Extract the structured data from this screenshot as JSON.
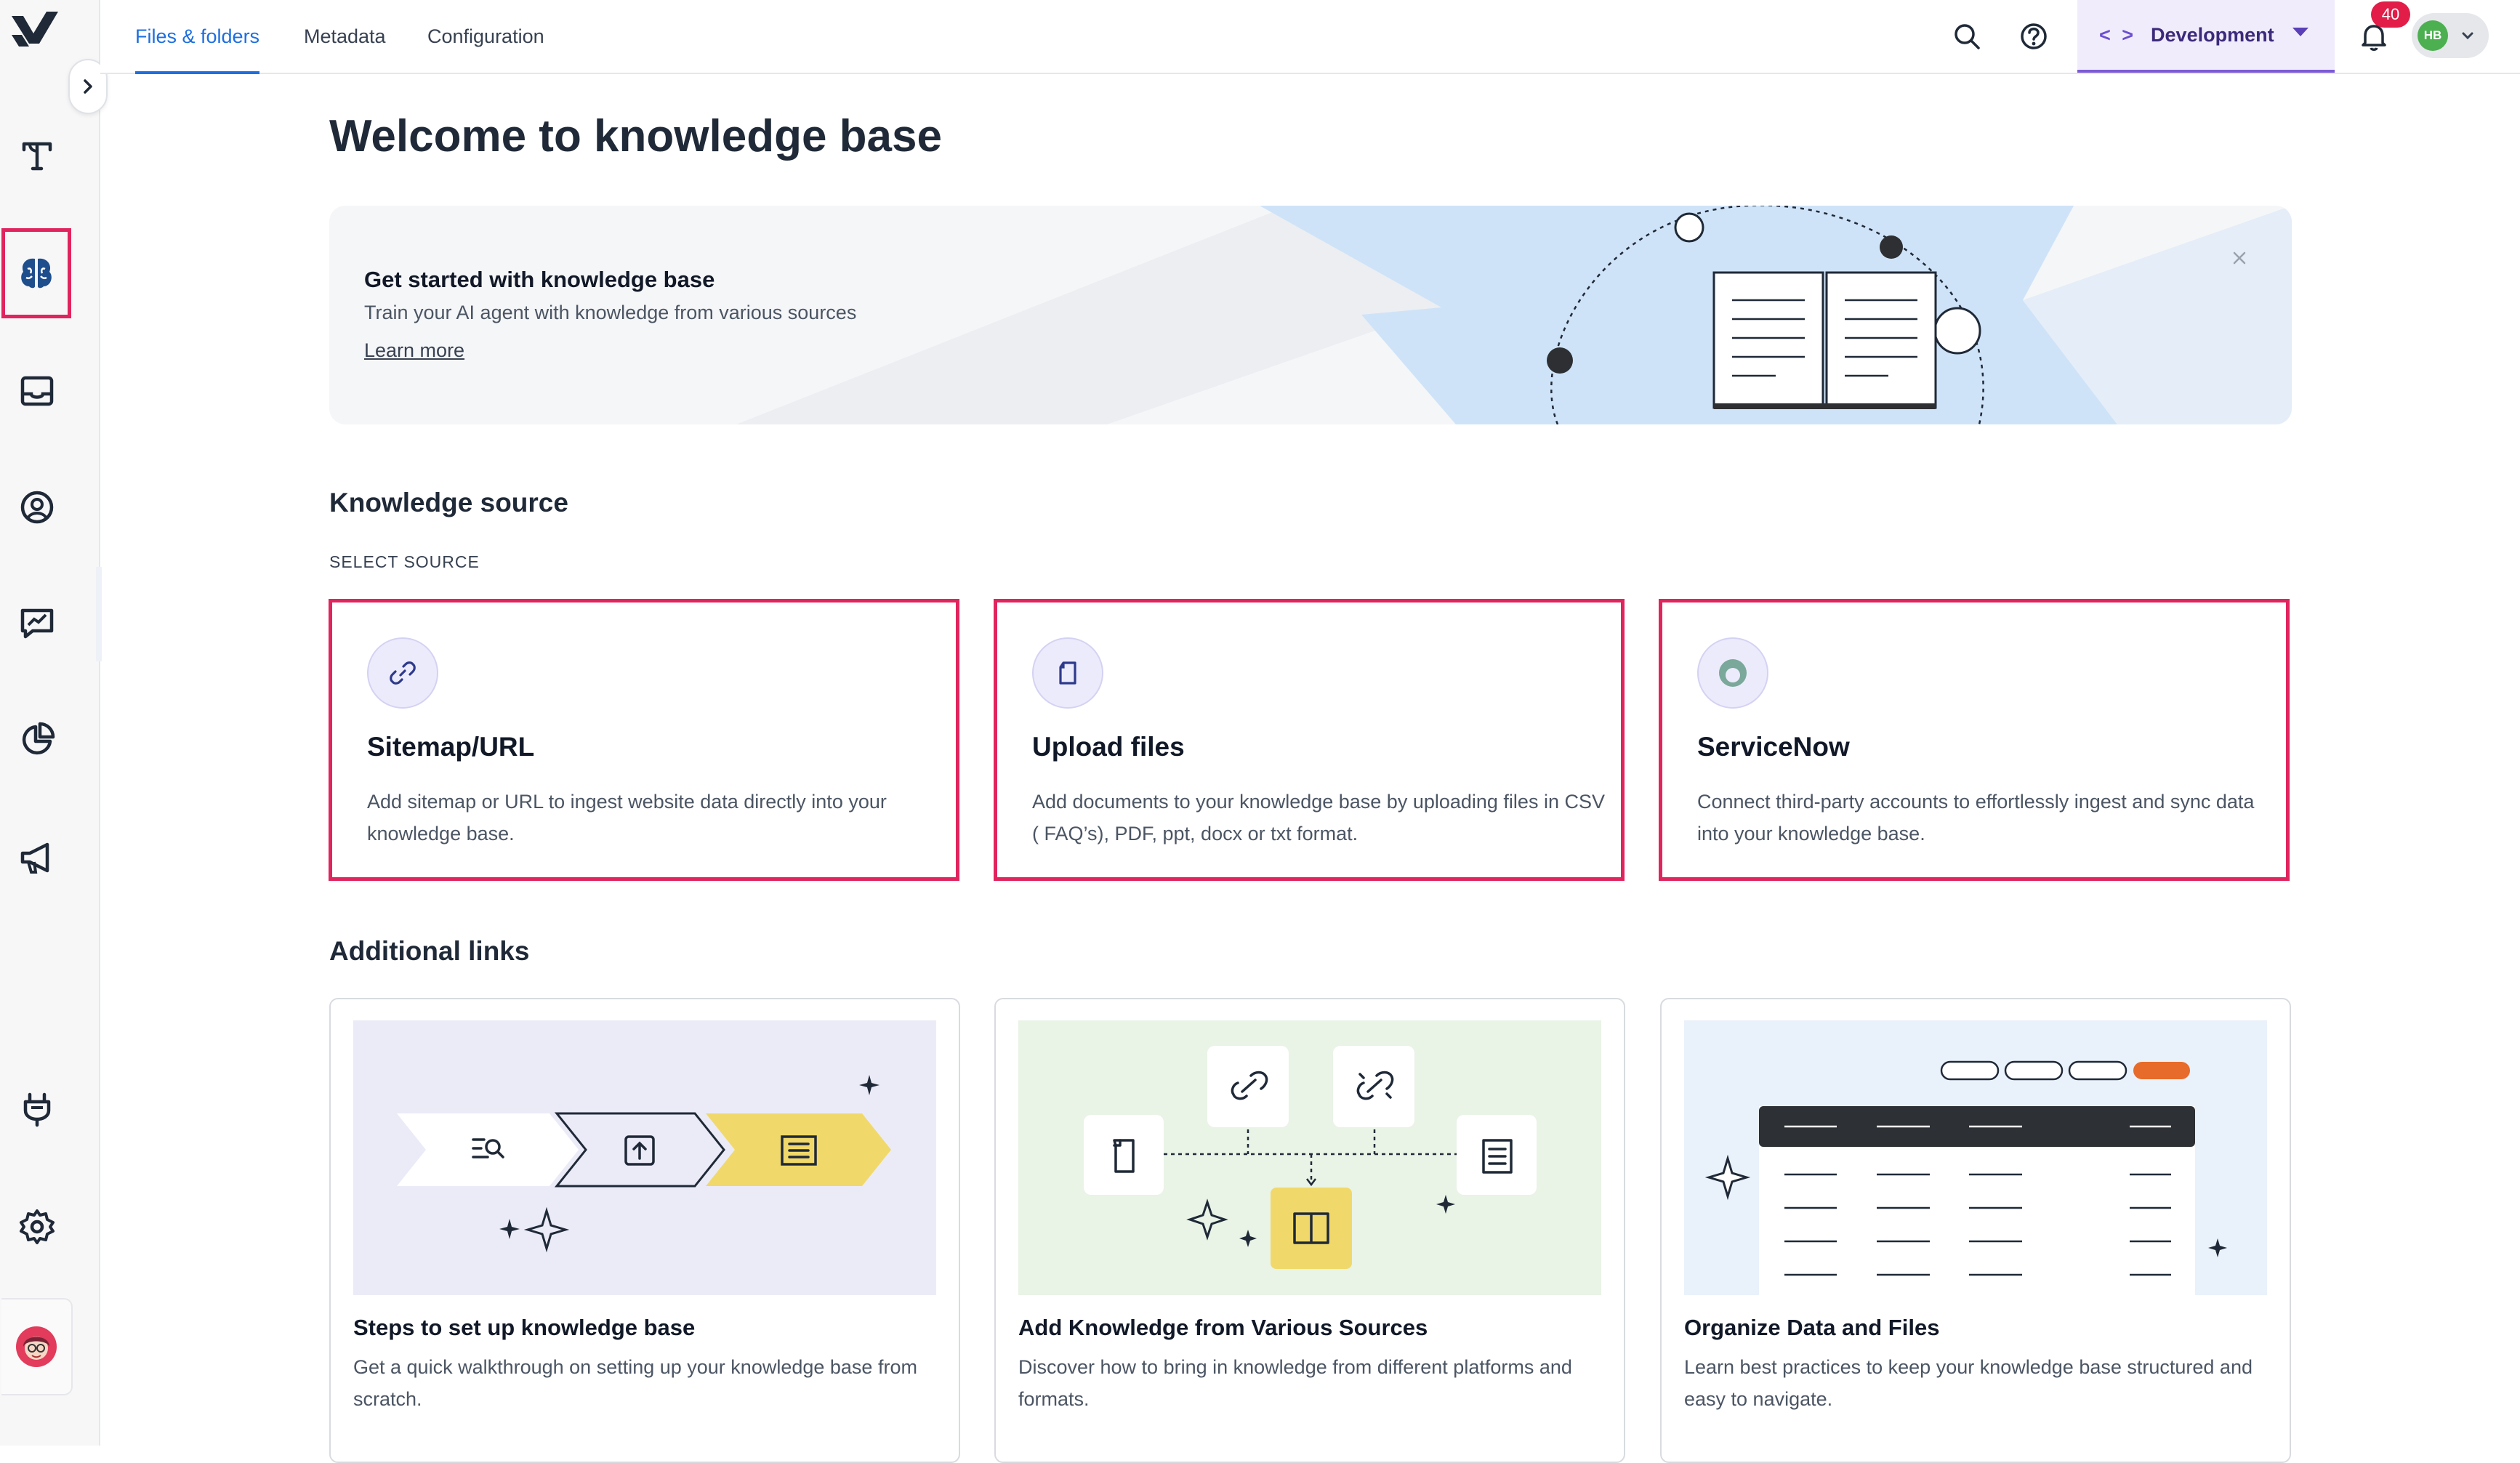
{
  "topbar": {
    "tabs": [
      {
        "label": "Files & folders"
      },
      {
        "label": "Metadata"
      },
      {
        "label": "Configuration"
      }
    ],
    "environment": "Development",
    "environment_code_glyph": "< >",
    "notifications_count": "40",
    "user_initials": "HB"
  },
  "rail": {
    "icons": [
      "logo-icon",
      "text-tool-icon",
      "knowledge-brain-icon",
      "inbox-icon",
      "contacts-icon",
      "analytics-chat-icon",
      "reports-pie-icon",
      "campaigns-megaphone-icon",
      "integrations-plug-icon",
      "settings-gear-icon",
      "user-avatar"
    ]
  },
  "main": {
    "title": "Welcome to knowledge base",
    "banner": {
      "title": "Get started with knowledge base",
      "subtitle": "Train your AI agent with knowledge from various sources",
      "link": "Learn more"
    },
    "knowledge_source": {
      "heading": "Knowledge source",
      "overline": "SELECT SOURCE",
      "cards": [
        {
          "title": "Sitemap/URL",
          "desc": "Add sitemap or URL to ingest website data directly into your knowledge base.",
          "icon": "link-icon"
        },
        {
          "title": "Upload files",
          "desc": "Add documents to your knowledge base by uploading files in CSV ( FAQ’s), PDF, ppt, docx or txt format.",
          "icon": "file-icon"
        },
        {
          "title": "ServiceNow",
          "desc": "Connect third-party accounts to effortlessly ingest and sync data into your knowledge base.",
          "icon": "servicenow-icon"
        }
      ]
    },
    "additional_links": {
      "heading": "Additional links",
      "cards": [
        {
          "title": "Steps to set up knowledge base",
          "desc": "Get a quick walkthrough on setting up your knowledge base from scratch."
        },
        {
          "title": "Add Knowledge from Various Sources",
          "desc": "Discover how to bring in knowledge from different platforms and formats."
        },
        {
          "title": "Organize Data and Files",
          "desc": "Learn best practices to keep your knowledge base structured and easy to navigate."
        }
      ]
    }
  },
  "colors": {
    "accent": "#1d6fe0",
    "highlight": "#e0245e",
    "env_bg": "#f1ecfb",
    "badge": "#e11d48"
  }
}
